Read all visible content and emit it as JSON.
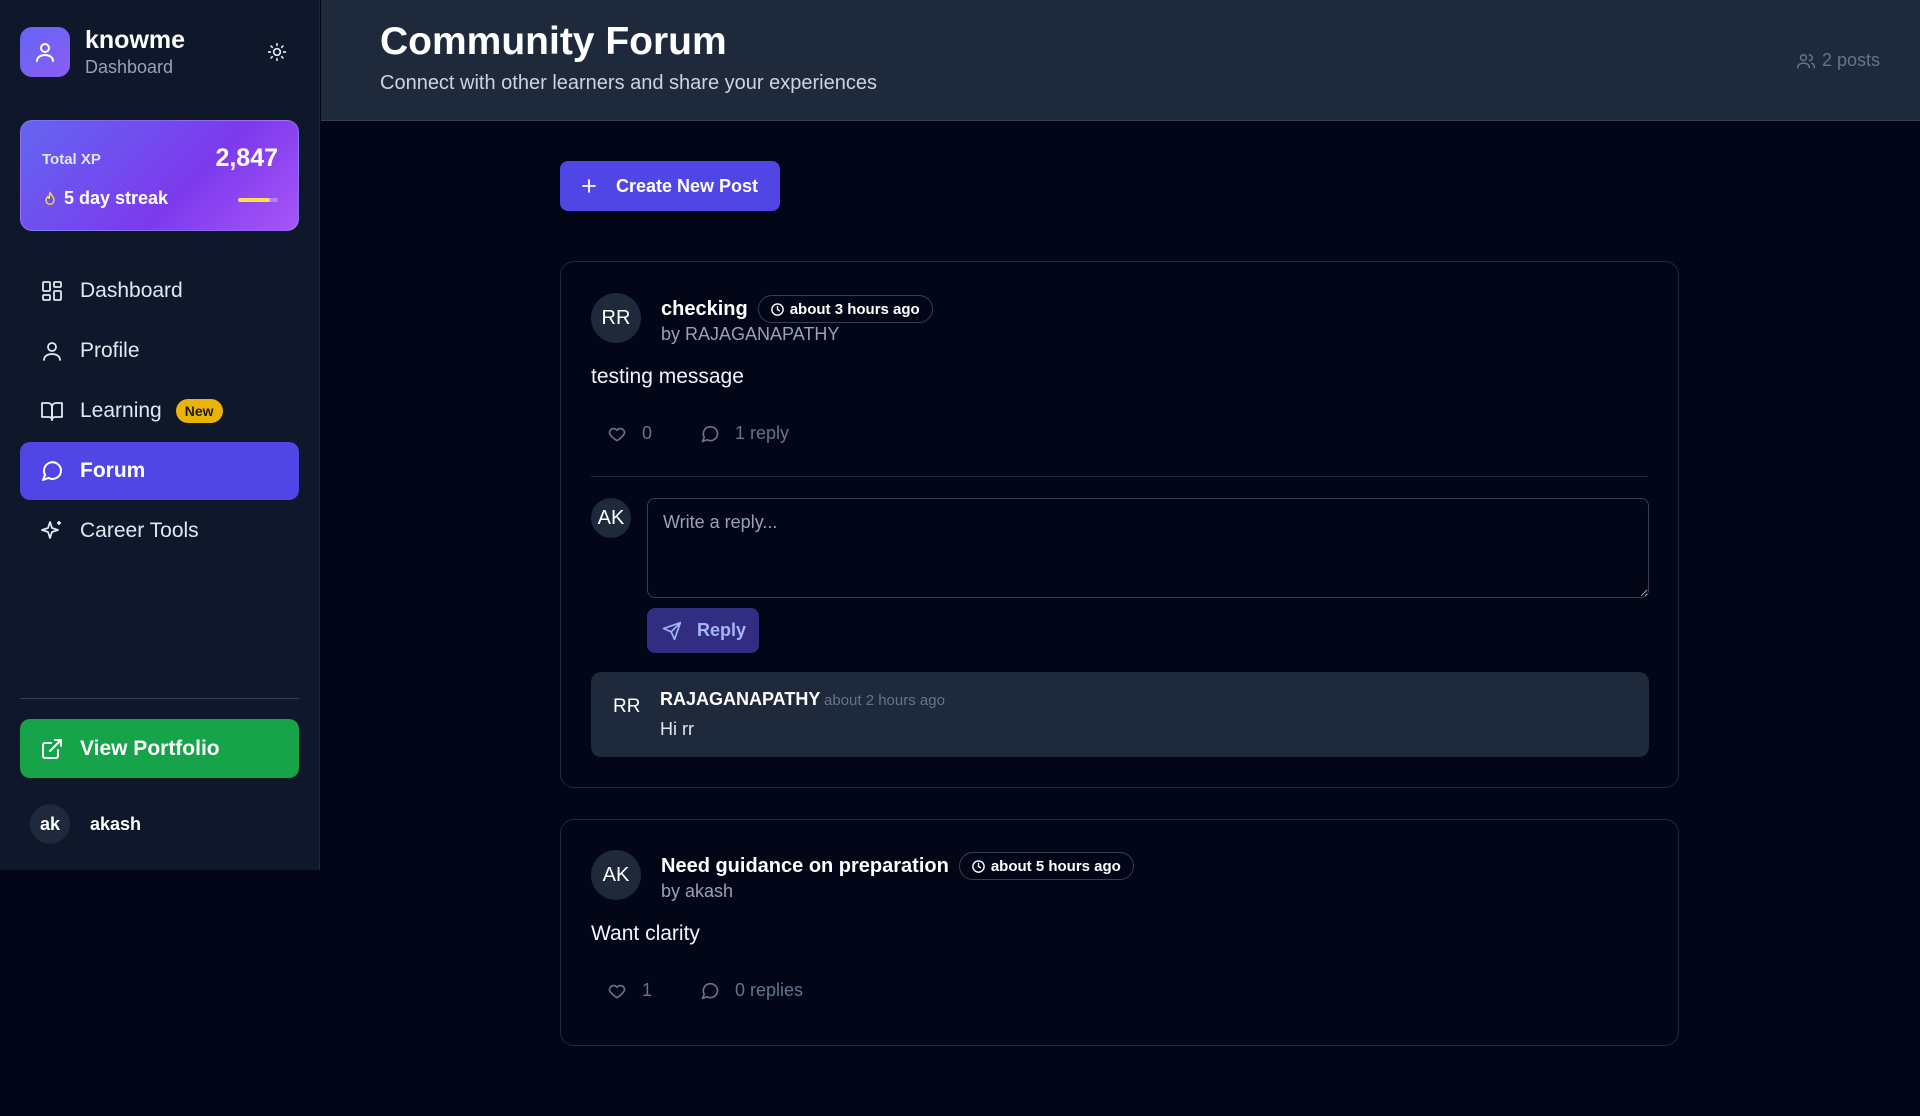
{
  "brand": {
    "title": "knowme",
    "subtitle": "Dashboard"
  },
  "xp": {
    "label": "Total XP",
    "value": "2,847",
    "streak": "5 day streak",
    "streak_progress": 0.8
  },
  "nav": {
    "items": [
      {
        "label": "Dashboard",
        "icon": "dashboard-icon"
      },
      {
        "label": "Profile",
        "icon": "user-icon"
      },
      {
        "label": "Learning",
        "icon": "book-icon",
        "badge": "New"
      },
      {
        "label": "Forum",
        "icon": "message-circle-icon",
        "active": true
      },
      {
        "label": "Career Tools",
        "icon": "sparkles-icon"
      }
    ]
  },
  "portfolio": {
    "label": "View Portfolio"
  },
  "user": {
    "initials": "ak",
    "name": "akash"
  },
  "header": {
    "title": "Community Forum",
    "subtitle": "Connect with other learners and share your experiences",
    "post_count": "2 posts"
  },
  "create_post": {
    "label": "Create New Post"
  },
  "posts": [
    {
      "initials": "RR",
      "title": "checking",
      "time": "about 3 hours ago",
      "author": "by RAJAGANAPATHY",
      "body": "testing message",
      "likes": "0",
      "replies_label": "1 reply",
      "reply_form": {
        "initials": "AK",
        "placeholder": "Write a reply...",
        "button": "Reply"
      },
      "replies": [
        {
          "initials": "RR",
          "author": "RAJAGANAPATHY",
          "time": "about 2 hours ago",
          "text": "Hi rr"
        }
      ]
    },
    {
      "initials": "AK",
      "title": "Need guidance on preparation",
      "time": "about 5 hours ago",
      "author": "by akash",
      "body": "Want clarity",
      "likes": "1",
      "replies_label": "0 replies"
    }
  ],
  "colors": {
    "accent": "#4f46e5",
    "background": "#020617",
    "sidebar": "#0f172a",
    "success": "#16a34a",
    "badge": "#eab308"
  }
}
